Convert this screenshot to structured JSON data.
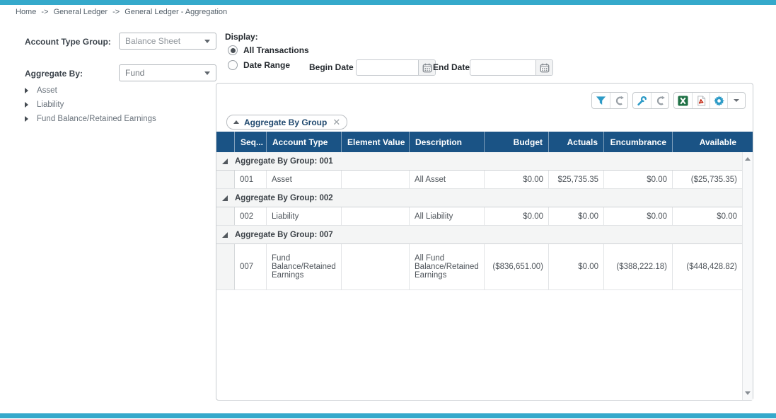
{
  "breadcrumb": {
    "separator": "->",
    "items": [
      {
        "label": "Home"
      },
      {
        "label": "General Ledger"
      },
      {
        "label": "General Ledger - Aggregation"
      }
    ]
  },
  "filters": {
    "account_type_group": {
      "label": "Account Type Group:",
      "value": "Balance Sheet"
    },
    "aggregate_by": {
      "label": "Aggregate By:",
      "value": "Fund"
    },
    "tree_items": [
      {
        "label": "Asset"
      },
      {
        "label": "Liability"
      },
      {
        "label": "Fund Balance/Retained Earnings"
      }
    ]
  },
  "display": {
    "label": "Display:",
    "all_transactions": {
      "label": "All Transactions",
      "selected": true
    },
    "date_range": {
      "label": "Date Range",
      "selected": false
    },
    "begin_date": {
      "label": "Begin Date",
      "value": ""
    },
    "end_date": {
      "label": "End Date",
      "value": ""
    }
  },
  "toolbar": {
    "icons": [
      "filter-icon",
      "refresh-icon",
      "customize-wrench-icon",
      "refresh-icon",
      "excel-export-icon",
      "pdf-export-icon",
      "settings-gear-icon",
      "more-dropdown-icon"
    ]
  },
  "grid": {
    "group_chip": {
      "label": "Aggregate By Group",
      "sort": "ascending"
    },
    "columns": [
      {
        "label": "Seq...",
        "align": "left"
      },
      {
        "label": "Account Type",
        "align": "left"
      },
      {
        "label": "Element Value",
        "align": "left"
      },
      {
        "label": "Description",
        "align": "left"
      },
      {
        "label": "Budget",
        "align": "right"
      },
      {
        "label": "Actuals",
        "align": "right"
      },
      {
        "label": "Encumbrance",
        "align": "right"
      },
      {
        "label": "Available",
        "align": "right"
      }
    ],
    "groups": [
      {
        "header": "Aggregate By Group: 001",
        "rows": [
          {
            "seq": "001",
            "account_type": "Asset",
            "element_value": "",
            "description": "All Asset",
            "budget": "$0.00",
            "actuals": "$25,735.35",
            "encumbrance": "$0.00",
            "available": "($25,735.35)"
          }
        ]
      },
      {
        "header": "Aggregate By Group: 002",
        "rows": [
          {
            "seq": "002",
            "account_type": "Liability",
            "element_value": "",
            "description": "All Liability",
            "budget": "$0.00",
            "actuals": "$0.00",
            "encumbrance": "$0.00",
            "available": "$0.00"
          }
        ]
      },
      {
        "header": "Aggregate By Group: 007",
        "rows": [
          {
            "seq": "007",
            "account_type": "Fund Balance/Retained Earnings",
            "element_value": "",
            "description": "All Fund Balance/Retained Earnings",
            "budget": "($836,651.00)",
            "actuals": "$0.00",
            "encumbrance": "($388,222.18)",
            "available": "($448,428.82)"
          }
        ]
      }
    ]
  },
  "colors": {
    "accent_teal": "#35a9cb",
    "header_blue": "#1a5385",
    "icon_blue": "#2d9bc7",
    "excel_green": "#1e7145",
    "pdf_red": "#c11e07",
    "chip_text": "#20496f"
  }
}
